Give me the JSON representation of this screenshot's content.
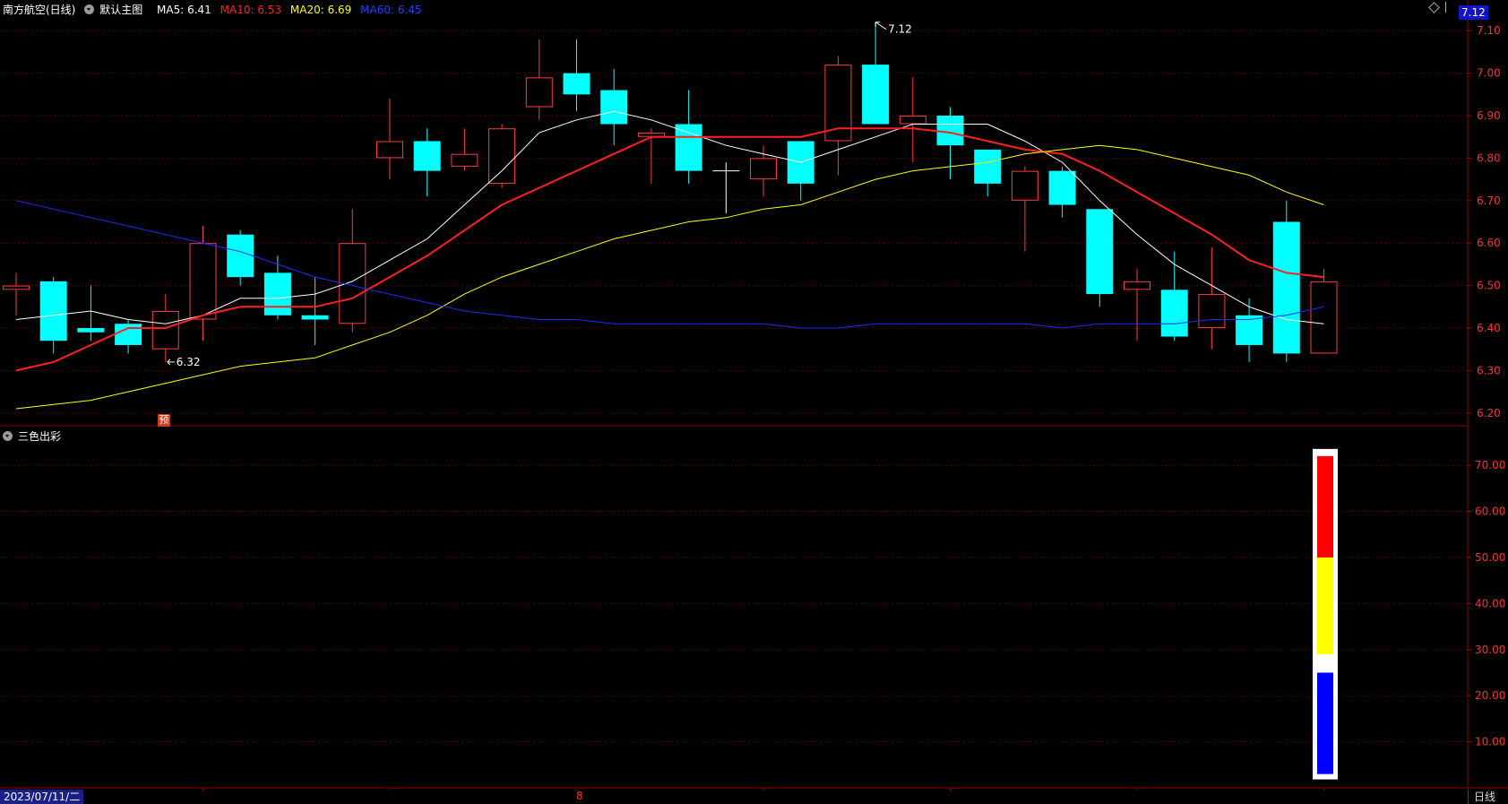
{
  "header": {
    "stock_name": "南方航空(日线)",
    "main_chart_label": "默认主图",
    "indicators": [
      {
        "label": "MA5: 6.41",
        "color": "#ffffff"
      },
      {
        "label": "MA10: 6.53",
        "color": "#ff2020"
      },
      {
        "label": "MA20: 6.69",
        "color": "#ffff00"
      },
      {
        "label": "MA60: 6.45",
        "color": "#2040ff"
      }
    ]
  },
  "current_price_tag": "7.12",
  "sub_panel_title": "三色出彩",
  "footer": {
    "date": "2023/07/11/二",
    "month_marker": "8",
    "period": "日线"
  },
  "badge_text": "预",
  "chart_data": [
    {
      "type": "candlestick",
      "ylim": [
        6.17,
        7.13
      ],
      "y_ticks": [
        "7.10",
        "7.00",
        "6.90",
        "6.80",
        "6.70",
        "6.60",
        "6.50",
        "6.40",
        "6.30",
        "6.20"
      ],
      "annotations": [
        {
          "text": "7.12",
          "candle": 23,
          "value": 7.12,
          "kind": "high"
        },
        {
          "text": "6.32",
          "candle": 4,
          "value": 6.32,
          "kind": "low"
        }
      ],
      "up_color": "#ff3b3b",
      "down_color": "#00ffff",
      "candles": [
        {
          "o": 6.49,
          "c": 6.5,
          "h": 6.53,
          "l": 6.43
        },
        {
          "o": 6.51,
          "c": 6.37,
          "h": 6.52,
          "l": 6.34
        },
        {
          "o": 6.4,
          "c": 6.39,
          "h": 6.5,
          "l": 6.37
        },
        {
          "o": 6.41,
          "c": 6.36,
          "h": 6.42,
          "l": 6.34
        },
        {
          "o": 6.35,
          "c": 6.44,
          "h": 6.48,
          "l": 6.32
        },
        {
          "o": 6.42,
          "c": 6.6,
          "h": 6.64,
          "l": 6.37
        },
        {
          "o": 6.62,
          "c": 6.52,
          "h": 6.63,
          "l": 6.5
        },
        {
          "o": 6.53,
          "c": 6.43,
          "h": 6.57,
          "l": 6.42
        },
        {
          "o": 6.43,
          "c": 6.42,
          "h": 6.52,
          "l": 6.36
        },
        {
          "o": 6.41,
          "c": 6.6,
          "h": 6.68,
          "l": 6.39
        },
        {
          "o": 6.8,
          "c": 6.84,
          "h": 6.94,
          "l": 6.75
        },
        {
          "o": 6.84,
          "c": 6.77,
          "h": 6.87,
          "l": 6.71
        },
        {
          "o": 6.78,
          "c": 6.81,
          "h": 6.87,
          "l": 6.77
        },
        {
          "o": 6.74,
          "c": 6.87,
          "h": 6.88,
          "l": 6.73
        },
        {
          "o": 6.92,
          "c": 6.99,
          "h": 7.08,
          "l": 6.89
        },
        {
          "o": 7.0,
          "c": 6.95,
          "h": 7.08,
          "l": 6.91
        },
        {
          "o": 6.96,
          "c": 6.88,
          "h": 7.01,
          "l": 6.83
        },
        {
          "o": 6.85,
          "c": 6.86,
          "h": 6.87,
          "l": 6.74
        },
        {
          "o": 6.88,
          "c": 6.77,
          "h": 6.96,
          "l": 6.74
        },
        {
          "o": 6.77,
          "c": 6.77,
          "h": 6.79,
          "l": 6.67
        },
        {
          "o": 6.75,
          "c": 6.8,
          "h": 6.83,
          "l": 6.71
        },
        {
          "o": 6.84,
          "c": 6.74,
          "h": 6.84,
          "l": 6.7
        },
        {
          "o": 6.84,
          "c": 7.02,
          "h": 7.04,
          "l": 6.76
        },
        {
          "o": 7.02,
          "c": 6.88,
          "h": 7.12,
          "l": 6.88
        },
        {
          "o": 6.88,
          "c": 6.9,
          "h": 6.99,
          "l": 6.79
        },
        {
          "o": 6.9,
          "c": 6.83,
          "h": 6.92,
          "l": 6.75
        },
        {
          "o": 6.82,
          "c": 6.74,
          "h": 6.82,
          "l": 6.71
        },
        {
          "o": 6.7,
          "c": 6.77,
          "h": 6.78,
          "l": 6.58
        },
        {
          "o": 6.77,
          "c": 6.69,
          "h": 6.78,
          "l": 6.66
        },
        {
          "o": 6.68,
          "c": 6.48,
          "h": 6.68,
          "l": 6.45
        },
        {
          "o": 6.49,
          "c": 6.51,
          "h": 6.54,
          "l": 6.37
        },
        {
          "o": 6.49,
          "c": 6.38,
          "h": 6.58,
          "l": 6.37
        },
        {
          "o": 6.4,
          "c": 6.48,
          "h": 6.59,
          "l": 6.35
        },
        {
          "o": 6.43,
          "c": 6.36,
          "h": 6.47,
          "l": 6.32
        },
        {
          "o": 6.65,
          "c": 6.34,
          "h": 6.7,
          "l": 6.32
        },
        {
          "o": 6.34,
          "c": 6.51,
          "h": 6.54,
          "l": 6.34
        }
      ],
      "ma_series": [
        {
          "name": "MA5",
          "color": "#ffffff",
          "width": 1,
          "values": [
            6.42,
            6.43,
            6.44,
            6.42,
            6.41,
            6.43,
            6.47,
            6.47,
            6.48,
            6.51,
            6.56,
            6.61,
            6.69,
            6.77,
            6.86,
            6.89,
            6.91,
            6.89,
            6.86,
            6.83,
            6.81,
            6.79,
            6.82,
            6.85,
            6.88,
            6.88,
            6.88,
            6.84,
            6.79,
            6.7,
            6.62,
            6.55,
            6.5,
            6.45,
            6.42,
            6.41
          ]
        },
        {
          "name": "MA10",
          "color": "#ff2020",
          "width": 2,
          "values": [
            6.3,
            6.32,
            6.36,
            6.4,
            6.4,
            6.43,
            6.45,
            6.45,
            6.45,
            6.47,
            6.52,
            6.57,
            6.63,
            6.69,
            6.73,
            6.77,
            6.81,
            6.85,
            6.85,
            6.85,
            6.85,
            6.85,
            6.87,
            6.87,
            6.87,
            6.86,
            6.84,
            6.82,
            6.81,
            6.77,
            6.72,
            6.67,
            6.62,
            6.56,
            6.53,
            6.52
          ]
        },
        {
          "name": "MA20",
          "color": "#ffff00",
          "width": 1,
          "values": [
            6.21,
            6.22,
            6.23,
            6.25,
            6.27,
            6.29,
            6.31,
            6.32,
            6.33,
            6.36,
            6.39,
            6.43,
            6.48,
            6.52,
            6.55,
            6.58,
            6.61,
            6.63,
            6.65,
            6.66,
            6.68,
            6.69,
            6.72,
            6.75,
            6.77,
            6.78,
            6.79,
            6.81,
            6.82,
            6.83,
            6.82,
            6.8,
            6.78,
            6.76,
            6.72,
            6.69
          ]
        },
        {
          "name": "MA60",
          "color": "#1a2cff",
          "width": 1,
          "values": [
            6.7,
            6.68,
            6.66,
            6.64,
            6.62,
            6.6,
            6.58,
            6.55,
            6.52,
            6.5,
            6.48,
            6.46,
            6.44,
            6.43,
            6.42,
            6.42,
            6.41,
            6.41,
            6.41,
            6.41,
            6.41,
            6.4,
            6.4,
            6.41,
            6.41,
            6.41,
            6.41,
            6.41,
            6.4,
            6.41,
            6.41,
            6.41,
            6.42,
            6.42,
            6.43,
            6.45
          ]
        }
      ]
    },
    {
      "type": "bar",
      "title": "三色出彩",
      "ylim": [
        0,
        78
      ],
      "y_ticks": [
        "70.00",
        "60.00",
        "50.00",
        "40.00",
        "30.00",
        "20.00",
        "10.00"
      ],
      "segments": [
        {
          "name": "red",
          "color": "#ff0000",
          "from": 50,
          "to": 72
        },
        {
          "name": "yellow",
          "color": "#ffff00",
          "from": 29,
          "to": 50
        },
        {
          "name": "blue",
          "color": "#0000ff",
          "from": 3,
          "to": 25
        }
      ]
    }
  ]
}
